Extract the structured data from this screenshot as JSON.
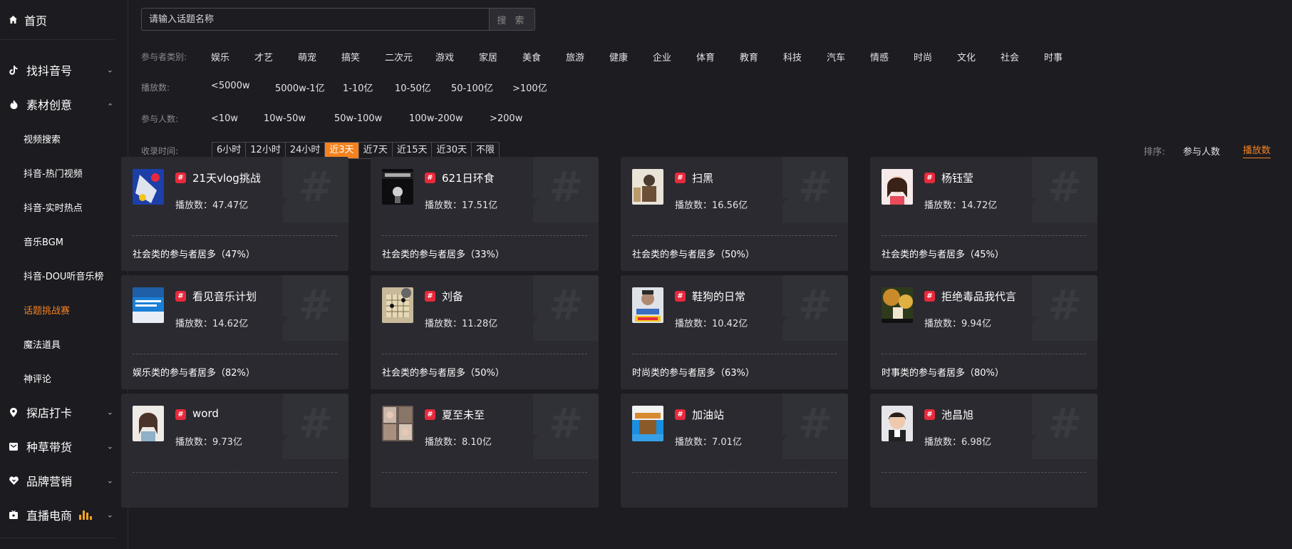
{
  "sidebar": {
    "home": "首页",
    "sections": [
      {
        "label": "找抖音号",
        "icon": "tiktok-icon"
      },
      {
        "label": "素材创意",
        "icon": "flame-icon",
        "expanded": true
      }
    ],
    "subitems": [
      "视频搜索",
      "抖音-热门视频",
      "抖音-实时热点",
      "音乐BGM",
      "抖音-DOU听音乐榜",
      "话题挑战赛",
      "魔法道具",
      "神评论"
    ],
    "active_sub": "话题挑战赛",
    "sections2": [
      {
        "label": "探店打卡",
        "icon": "location-pin-icon"
      },
      {
        "label": "种草带货",
        "icon": "mail-icon"
      },
      {
        "label": "品牌营销",
        "icon": "heart-icon"
      },
      {
        "label": "直播电商",
        "icon": "tv-icon"
      }
    ]
  },
  "search": {
    "placeholder": "请输入话题名称",
    "button": "搜 索"
  },
  "filters": {
    "category_label": "参与者类别:",
    "categories": [
      "娱乐",
      "才艺",
      "萌宠",
      "搞笑",
      "二次元",
      "游戏",
      "家居",
      "美食",
      "旅游",
      "健康",
      "企业",
      "体育",
      "教育",
      "科技",
      "汽车",
      "情感",
      "时尚",
      "文化",
      "社会",
      "时事"
    ],
    "plays_label": "播放数:",
    "plays": [
      "<5000w",
      "5000w-1亿",
      "1-10亿",
      "10-50亿",
      "50-100亿",
      ">100亿"
    ],
    "people_label": "参与人数:",
    "people": [
      "<10w",
      "10w-50w",
      "50w-100w",
      "100w-200w",
      ">200w"
    ],
    "time_label": "收录时间:",
    "times": [
      "6小时",
      "12小时",
      "24小时",
      "近3天",
      "近7天",
      "近15天",
      "近30天",
      "不限"
    ],
    "time_selected": "近3天"
  },
  "sort": {
    "label": "排序:",
    "options": [
      "参与人数",
      "播放数"
    ],
    "selected": "播放数"
  },
  "cards": [
    {
      "name": "21天vlog挑战",
      "plays": "播放数：47.47亿",
      "stat": "社会类的参与者居多（47%）"
    },
    {
      "name": "621日环食",
      "plays": "播放数：17.51亿",
      "stat": "社会类的参与者居多（33%）"
    },
    {
      "name": "扫黑",
      "plays": "播放数：16.56亿",
      "stat": "社会类的参与者居多（50%）"
    },
    {
      "name": "杨钰莹",
      "plays": "播放数：14.72亿",
      "stat": "社会类的参与者居多（45%）"
    },
    {
      "name": "看见音乐计划",
      "plays": "播放数：14.62亿",
      "stat": "娱乐类的参与者居多（82%）"
    },
    {
      "name": "刘备",
      "plays": "播放数：11.28亿",
      "stat": "社会类的参与者居多（50%）"
    },
    {
      "name": "鞋狗的日常",
      "plays": "播放数：10.42亿",
      "stat": "时尚类的参与者居多（63%）"
    },
    {
      "name": "拒绝毒品我代言",
      "plays": "播放数：9.94亿",
      "stat": "时事类的参与者居多（80%）"
    },
    {
      "name": "word",
      "plays": "播放数：9.73亿",
      "stat": ""
    },
    {
      "name": "夏至未至",
      "plays": "播放数：8.10亿",
      "stat": ""
    },
    {
      "name": "加油站",
      "plays": "播放数：7.01亿",
      "stat": ""
    },
    {
      "name": "池昌旭",
      "plays": "播放数：6.98亿",
      "stat": ""
    }
  ],
  "colors": {
    "accent": "#f5821f",
    "tag": "#e8293c",
    "card": "#2a2a30",
    "bg": "#1c1c21"
  }
}
